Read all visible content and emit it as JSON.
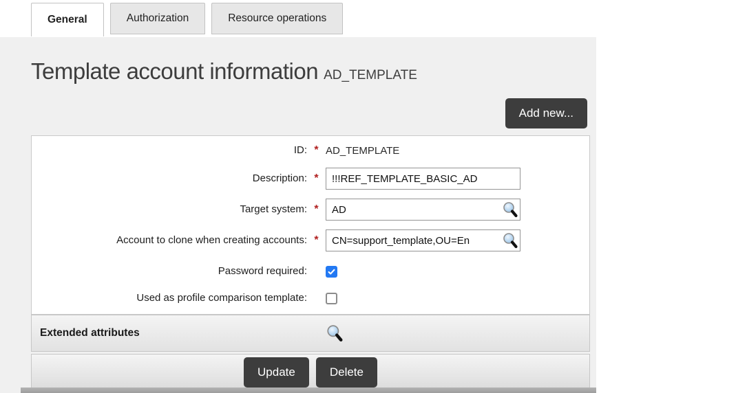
{
  "tabs": [
    {
      "label": "General",
      "active": true
    },
    {
      "label": "Authorization",
      "active": false
    },
    {
      "label": "Resource operations",
      "active": false
    }
  ],
  "header": {
    "title": "Template account information",
    "subtitle": "AD_TEMPLATE",
    "add_button_label": "Add new..."
  },
  "form": {
    "required_marker": "*",
    "fields": [
      {
        "label": "ID:",
        "required": true,
        "type": "static",
        "value": "AD_TEMPLATE"
      },
      {
        "label": "Description:",
        "required": true,
        "type": "text",
        "value": "!!!REF_TEMPLATE_BASIC_AD"
      },
      {
        "label": "Target system:",
        "required": true,
        "type": "lookup",
        "value": "AD"
      },
      {
        "label": "Account to clone when creating accounts:",
        "required": true,
        "type": "lookup",
        "value": "CN=support_template,OU=En"
      },
      {
        "label": "Password required:",
        "required": false,
        "type": "checkbox",
        "checked": true
      },
      {
        "label": "Used as profile comparison template:",
        "required": false,
        "type": "checkbox",
        "checked": false
      }
    ],
    "extended_attributes_label": "Extended attributes",
    "update_button_label": "Update",
    "delete_button_label": "Delete"
  },
  "icons": {
    "lookup": "magnifier-icon"
  },
  "colors": {
    "content_background": "#f0f0f0",
    "dark_button": "#3d3d3d",
    "required_asterisk": "#b01f1f",
    "checkbox_checked": "#2379f3",
    "tab_inactive": "#e7e7e7"
  }
}
